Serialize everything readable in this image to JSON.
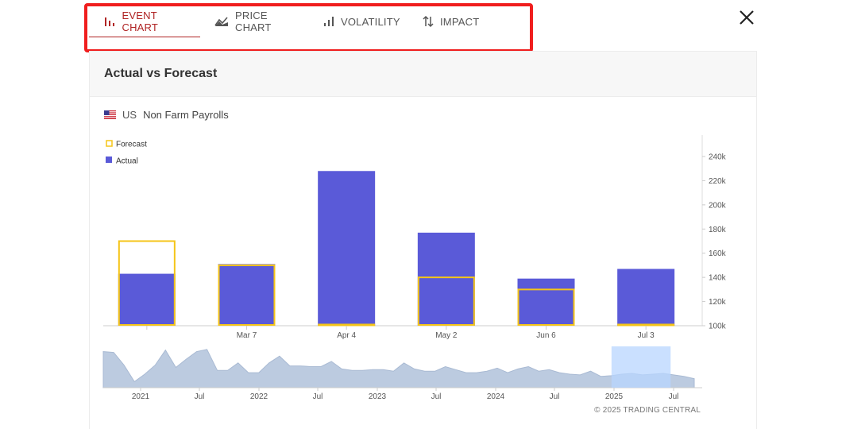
{
  "tabs": [
    {
      "label": "EVENT CHART",
      "icon": "bar-chart-icon",
      "active": true
    },
    {
      "label": "PRICE CHART",
      "icon": "price-chart-icon",
      "active": false
    },
    {
      "label": "VOLATILITY",
      "icon": "volatility-icon",
      "active": false
    },
    {
      "label": "IMPACT",
      "icon": "impact-arrows-icon",
      "active": false
    }
  ],
  "panel": {
    "title": "Actual vs Forecast",
    "country": "US",
    "event": "Non Farm Payrolls",
    "copyright": "© 2025 TRADING CENTRAL"
  },
  "colors": {
    "accent": "#b02424",
    "highlight_border": "#f01e1e",
    "actual": "#5a5ad8",
    "forecast": "#f5c518",
    "navigator_area": "#bccbe0",
    "navigator_window": "#b8d6ff"
  },
  "chart_data": {
    "type": "bar",
    "legend": [
      {
        "name": "Forecast",
        "style": "outline",
        "color": "#f5c518"
      },
      {
        "name": "Actual",
        "style": "filled",
        "color": "#5a5ad8"
      }
    ],
    "legend_position": "top-left",
    "categories": [
      "",
      "Mar 7",
      "Apr 4",
      "May 2",
      "Jun 6",
      "Jul 3"
    ],
    "series": [
      {
        "name": "Actual",
        "values": [
          143,
          151,
          228,
          177,
          139,
          147
        ]
      },
      {
        "name": "Forecast",
        "values": [
          170,
          150,
          101,
          140,
          130,
          101
        ]
      }
    ],
    "y_unit": "k",
    "y_ticks": [
      100,
      120,
      140,
      160,
      180,
      200,
      220,
      240
    ],
    "ylim": [
      100,
      250
    ],
    "y_axis_side": "right",
    "grid": false,
    "navigator": {
      "type": "area",
      "x_labels": [
        "2021",
        "Jul",
        "2022",
        "Jul",
        "2023",
        "Jul",
        "2024",
        "Jul",
        "2025",
        "Jul"
      ],
      "values": [
        48,
        47,
        30,
        8,
        18,
        30,
        50,
        27,
        38,
        48,
        51,
        23,
        23,
        33,
        20,
        20,
        33,
        42,
        29,
        29,
        28,
        28,
        35,
        25,
        23,
        23,
        24,
        24,
        22,
        33,
        25,
        22,
        22,
        28,
        24,
        20,
        20,
        22,
        26,
        20,
        25,
        28,
        22,
        24,
        20,
        18,
        17,
        22,
        15,
        16,
        18,
        19,
        17,
        18,
        19,
        17,
        15,
        12
      ],
      "ylim": [
        0,
        55
      ],
      "selected_range": [
        0.86,
        0.96
      ]
    }
  }
}
